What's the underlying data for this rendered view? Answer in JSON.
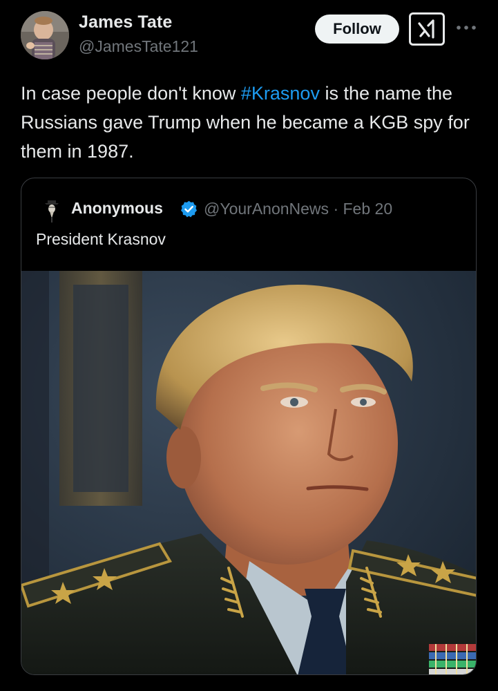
{
  "tweet": {
    "author_name": "James Tate",
    "author_handle": "@JamesTate121",
    "follow_label": "Follow",
    "grok_icon": "grok-icon",
    "more_icon": "more-dots-icon",
    "text_before": "In case people don't know ",
    "hashtag": "#Krasnov",
    "text_after": " is the name the Russians gave Trump when he became a KGB spy for them in 1987.",
    "hashtag_color": "#1d9bf0"
  },
  "quote": {
    "author_name": "Anonymous",
    "verified_icon": "verified-badge-icon",
    "handle": "@YourAnonNews",
    "separator": "·",
    "date": "Feb 20",
    "text": "President Krasnov"
  },
  "colors": {
    "background": "#000000",
    "text_primary": "#e7e9ea",
    "text_secondary": "#71767b",
    "follow_bg": "#eff3f4",
    "border": "#3a3d41"
  }
}
